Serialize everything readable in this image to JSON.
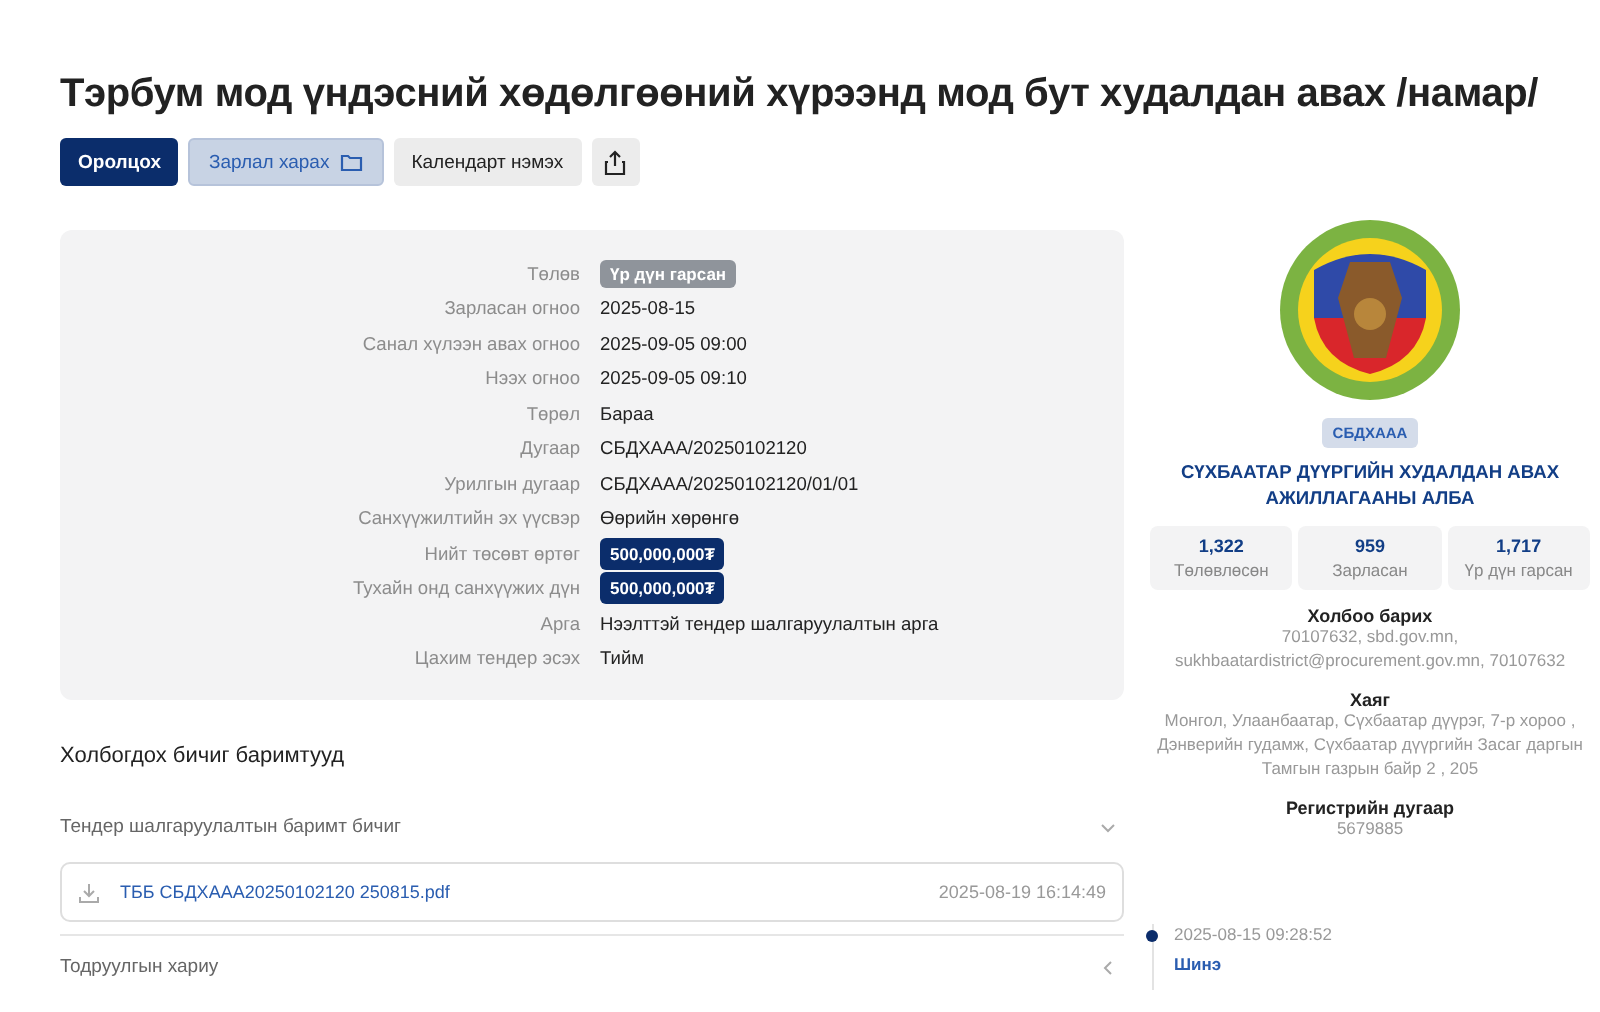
{
  "title": "Тэрбум мод үндэсний хөдөлгөөний хүрээнд мод бут худалдан авах /намар/",
  "actions": [
    {
      "label": "Оролцох",
      "kind": "primary"
    },
    {
      "label": "Зарлал харах",
      "kind": "folder"
    },
    {
      "label": "Календарт нэмэх",
      "kind": "plain"
    },
    {
      "kind": "share"
    }
  ],
  "details": [
    {
      "label": "Төлөв",
      "value": "Үр дүн гарсан",
      "kind": "status"
    },
    {
      "label": "Зарласан огноо",
      "value": "2025-08-15",
      "kind": "text"
    },
    {
      "label": "Санал хүлээн авах огноо",
      "value": "2025-09-05 09:00",
      "kind": "text"
    },
    {
      "label": "Нээх огноо",
      "value": "2025-09-05 09:10",
      "kind": "text"
    },
    {
      "label": "Төрөл",
      "value": "Бараа",
      "kind": "text"
    },
    {
      "label": "Дугаар",
      "value": "СБДХААА/20250102120",
      "kind": "text"
    },
    {
      "label": "Урилгын дугаар",
      "value": "СБДХААА/20250102120/01/01",
      "kind": "text"
    },
    {
      "label": "Санхүүжилтийн эх үүсвэр",
      "value": "Өөрийн хөрөнгө",
      "kind": "text"
    },
    {
      "label": "Нийт төсөвт өртөг",
      "value": "500,000,000₮",
      "kind": "amount"
    },
    {
      "label": "Тухайн онд санхүүжих дүн",
      "value": "500,000,000₮",
      "kind": "amount"
    },
    {
      "label": "Арга",
      "value": "Нээлттэй тендер шалгаруулалтын арга",
      "kind": "text"
    },
    {
      "label": "Цахим тендер эсэх",
      "value": "Тийм",
      "kind": "text"
    }
  ],
  "documents": {
    "heading": "Холбогдох бичиг баримтууд",
    "sections": [
      {
        "title": "Тендер шалгаруулалтын баримт бичиг",
        "expanded": true,
        "files": [
          {
            "name": "ТББ СБДХААА20250102120 250815.pdf",
            "date": "2025-08-19 16:14:49"
          }
        ]
      },
      {
        "title": "Тодруулгын хариу",
        "expanded": false
      }
    ]
  },
  "organization": {
    "code": "СБДХААА",
    "name": "СҮХБААТАР ДҮҮРГИЙН ХУДАЛДАН АВАХ АЖИЛЛАГААНЫ АЛБА",
    "stats": [
      {
        "value": "1,322",
        "label": "Төлөвлөсөн"
      },
      {
        "value": "959",
        "label": "Зарласан"
      },
      {
        "value": "1,717",
        "label": "Үр дүн гарсан"
      }
    ],
    "info": [
      {
        "heading": "Холбоо барих",
        "text": "70107632, sbd.gov.mn, sukhbaatardistrict@procurement.gov.mn, 70107632"
      },
      {
        "heading": "Хаяг",
        "text": "Монгол, Улаанбаатар, Сүхбаатар дүүрэг, 7-р хороо , Дэнверийн гудамж, Сүхбаатар дүүргийн Засаг даргын Тамгын газрын байр 2 , 205"
      },
      {
        "heading": "Регистрийн дугаар",
        "text": "5679885"
      }
    ]
  },
  "timeline": [
    {
      "time": "2025-08-15 09:28:52",
      "label": "Шинэ"
    }
  ]
}
